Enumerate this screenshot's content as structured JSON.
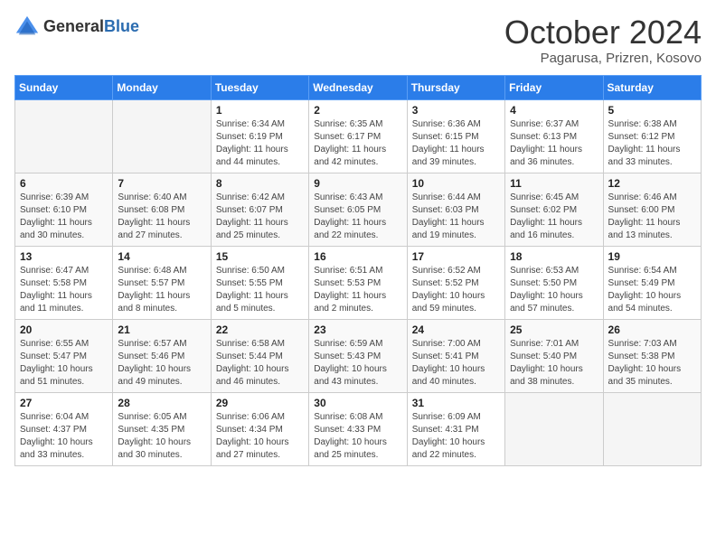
{
  "header": {
    "logo_general": "General",
    "logo_blue": "Blue",
    "month": "October 2024",
    "location": "Pagarusa, Prizren, Kosovo"
  },
  "days_of_week": [
    "Sunday",
    "Monday",
    "Tuesday",
    "Wednesday",
    "Thursday",
    "Friday",
    "Saturday"
  ],
  "weeks": [
    [
      {
        "day": "",
        "empty": true
      },
      {
        "day": "",
        "empty": true
      },
      {
        "day": "1",
        "sunrise": "Sunrise: 6:34 AM",
        "sunset": "Sunset: 6:19 PM",
        "daylight": "Daylight: 11 hours and 44 minutes."
      },
      {
        "day": "2",
        "sunrise": "Sunrise: 6:35 AM",
        "sunset": "Sunset: 6:17 PM",
        "daylight": "Daylight: 11 hours and 42 minutes."
      },
      {
        "day": "3",
        "sunrise": "Sunrise: 6:36 AM",
        "sunset": "Sunset: 6:15 PM",
        "daylight": "Daylight: 11 hours and 39 minutes."
      },
      {
        "day": "4",
        "sunrise": "Sunrise: 6:37 AM",
        "sunset": "Sunset: 6:13 PM",
        "daylight": "Daylight: 11 hours and 36 minutes."
      },
      {
        "day": "5",
        "sunrise": "Sunrise: 6:38 AM",
        "sunset": "Sunset: 6:12 PM",
        "daylight": "Daylight: 11 hours and 33 minutes."
      }
    ],
    [
      {
        "day": "6",
        "sunrise": "Sunrise: 6:39 AM",
        "sunset": "Sunset: 6:10 PM",
        "daylight": "Daylight: 11 hours and 30 minutes."
      },
      {
        "day": "7",
        "sunrise": "Sunrise: 6:40 AM",
        "sunset": "Sunset: 6:08 PM",
        "daylight": "Daylight: 11 hours and 27 minutes."
      },
      {
        "day": "8",
        "sunrise": "Sunrise: 6:42 AM",
        "sunset": "Sunset: 6:07 PM",
        "daylight": "Daylight: 11 hours and 25 minutes."
      },
      {
        "day": "9",
        "sunrise": "Sunrise: 6:43 AM",
        "sunset": "Sunset: 6:05 PM",
        "daylight": "Daylight: 11 hours and 22 minutes."
      },
      {
        "day": "10",
        "sunrise": "Sunrise: 6:44 AM",
        "sunset": "Sunset: 6:03 PM",
        "daylight": "Daylight: 11 hours and 19 minutes."
      },
      {
        "day": "11",
        "sunrise": "Sunrise: 6:45 AM",
        "sunset": "Sunset: 6:02 PM",
        "daylight": "Daylight: 11 hours and 16 minutes."
      },
      {
        "day": "12",
        "sunrise": "Sunrise: 6:46 AM",
        "sunset": "Sunset: 6:00 PM",
        "daylight": "Daylight: 11 hours and 13 minutes."
      }
    ],
    [
      {
        "day": "13",
        "sunrise": "Sunrise: 6:47 AM",
        "sunset": "Sunset: 5:58 PM",
        "daylight": "Daylight: 11 hours and 11 minutes."
      },
      {
        "day": "14",
        "sunrise": "Sunrise: 6:48 AM",
        "sunset": "Sunset: 5:57 PM",
        "daylight": "Daylight: 11 hours and 8 minutes."
      },
      {
        "day": "15",
        "sunrise": "Sunrise: 6:50 AM",
        "sunset": "Sunset: 5:55 PM",
        "daylight": "Daylight: 11 hours and 5 minutes."
      },
      {
        "day": "16",
        "sunrise": "Sunrise: 6:51 AM",
        "sunset": "Sunset: 5:53 PM",
        "daylight": "Daylight: 11 hours and 2 minutes."
      },
      {
        "day": "17",
        "sunrise": "Sunrise: 6:52 AM",
        "sunset": "Sunset: 5:52 PM",
        "daylight": "Daylight: 10 hours and 59 minutes."
      },
      {
        "day": "18",
        "sunrise": "Sunrise: 6:53 AM",
        "sunset": "Sunset: 5:50 PM",
        "daylight": "Daylight: 10 hours and 57 minutes."
      },
      {
        "day": "19",
        "sunrise": "Sunrise: 6:54 AM",
        "sunset": "Sunset: 5:49 PM",
        "daylight": "Daylight: 10 hours and 54 minutes."
      }
    ],
    [
      {
        "day": "20",
        "sunrise": "Sunrise: 6:55 AM",
        "sunset": "Sunset: 5:47 PM",
        "daylight": "Daylight: 10 hours and 51 minutes."
      },
      {
        "day": "21",
        "sunrise": "Sunrise: 6:57 AM",
        "sunset": "Sunset: 5:46 PM",
        "daylight": "Daylight: 10 hours and 49 minutes."
      },
      {
        "day": "22",
        "sunrise": "Sunrise: 6:58 AM",
        "sunset": "Sunset: 5:44 PM",
        "daylight": "Daylight: 10 hours and 46 minutes."
      },
      {
        "day": "23",
        "sunrise": "Sunrise: 6:59 AM",
        "sunset": "Sunset: 5:43 PM",
        "daylight": "Daylight: 10 hours and 43 minutes."
      },
      {
        "day": "24",
        "sunrise": "Sunrise: 7:00 AM",
        "sunset": "Sunset: 5:41 PM",
        "daylight": "Daylight: 10 hours and 40 minutes."
      },
      {
        "day": "25",
        "sunrise": "Sunrise: 7:01 AM",
        "sunset": "Sunset: 5:40 PM",
        "daylight": "Daylight: 10 hours and 38 minutes."
      },
      {
        "day": "26",
        "sunrise": "Sunrise: 7:03 AM",
        "sunset": "Sunset: 5:38 PM",
        "daylight": "Daylight: 10 hours and 35 minutes."
      }
    ],
    [
      {
        "day": "27",
        "sunrise": "Sunrise: 6:04 AM",
        "sunset": "Sunset: 4:37 PM",
        "daylight": "Daylight: 10 hours and 33 minutes."
      },
      {
        "day": "28",
        "sunrise": "Sunrise: 6:05 AM",
        "sunset": "Sunset: 4:35 PM",
        "daylight": "Daylight: 10 hours and 30 minutes."
      },
      {
        "day": "29",
        "sunrise": "Sunrise: 6:06 AM",
        "sunset": "Sunset: 4:34 PM",
        "daylight": "Daylight: 10 hours and 27 minutes."
      },
      {
        "day": "30",
        "sunrise": "Sunrise: 6:08 AM",
        "sunset": "Sunset: 4:33 PM",
        "daylight": "Daylight: 10 hours and 25 minutes."
      },
      {
        "day": "31",
        "sunrise": "Sunrise: 6:09 AM",
        "sunset": "Sunset: 4:31 PM",
        "daylight": "Daylight: 10 hours and 22 minutes."
      },
      {
        "day": "",
        "empty": true
      },
      {
        "day": "",
        "empty": true
      }
    ]
  ]
}
